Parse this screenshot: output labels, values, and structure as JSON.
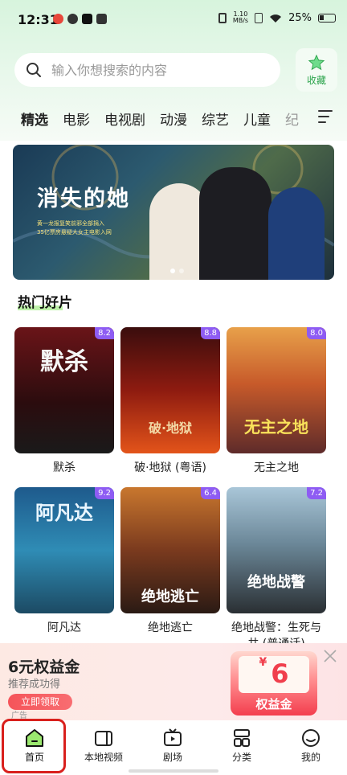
{
  "status_bar": {
    "time": "12:31",
    "net_speed_value": "1.10",
    "net_speed_unit": "MB/s",
    "battery": "25%"
  },
  "search": {
    "placeholder": "输入你想搜索的内容"
  },
  "favorite": {
    "label": "收藏"
  },
  "tabs": [
    {
      "label": "精选"
    },
    {
      "label": "电影"
    },
    {
      "label": "电视剧"
    },
    {
      "label": "动漫"
    },
    {
      "label": "综艺"
    },
    {
      "label": "儿童"
    },
    {
      "label": "纪"
    }
  ],
  "banner": {
    "title": "消失的她",
    "subtitle_line1": "黄一龙报复笑前邪全部捐入",
    "subtitle_line2": "35亿票房悬疑大女主电影入网"
  },
  "section": {
    "title": "热门好片"
  },
  "movies": [
    {
      "title": "默杀",
      "score": "8.2",
      "poster_text": "默杀"
    },
    {
      "title": "破·地狱 (粤语)",
      "score": "8.8",
      "poster_text": "破·地狱"
    },
    {
      "title": "无主之地",
      "score": "8.0",
      "poster_text": "无主之地"
    },
    {
      "title": "阿凡达",
      "score": "9.2",
      "poster_text": "阿凡达"
    },
    {
      "title": "绝地逃亡",
      "score": "6.4",
      "poster_text": "绝地逃亡"
    },
    {
      "title": "绝地战警：生死与共 (普通话)",
      "score": "7.2",
      "poster_text": "绝地战警"
    }
  ],
  "promo": {
    "title": "6元权益金",
    "subtitle": "推荐成功得",
    "button": "立即领取",
    "ad_label": "广告",
    "coupon_yen": "¥",
    "coupon_amount": "6",
    "coupon_label": "权益金"
  },
  "bottom_nav": [
    {
      "label": "首页"
    },
    {
      "label": "本地视频"
    },
    {
      "label": "剧场"
    },
    {
      "label": "分类"
    },
    {
      "label": "我的"
    }
  ],
  "colors": {
    "accent_green": "#2aa34a",
    "score_badge": "#8e5cf3",
    "promo_red": "#f03e4c"
  }
}
